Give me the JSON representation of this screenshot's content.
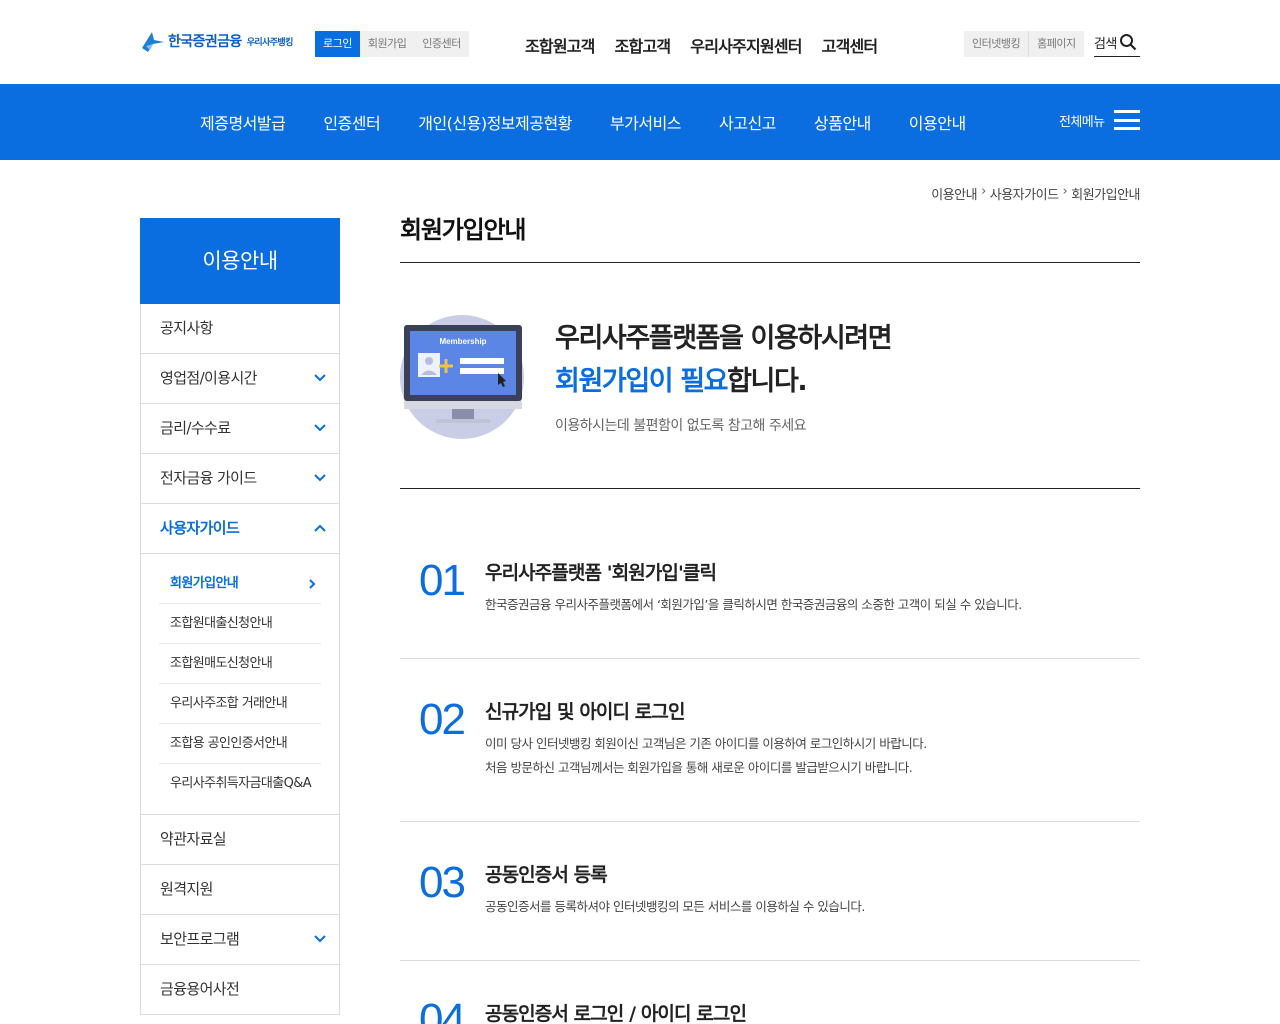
{
  "header": {
    "logo_main": "한국증권금융",
    "logo_sub": "우리사주뱅킹",
    "util_buttons": [
      "로그인",
      "회원가입",
      "인증센터"
    ],
    "gnb_top": [
      "조합원고객",
      "조합고객",
      "우리사주지원센터",
      "고객센터"
    ],
    "right_buttons": [
      "인터넷뱅킹",
      "홈페이지"
    ],
    "search_label": "검색"
  },
  "bluebar": {
    "menu": [
      "제증명서발급",
      "인증센터",
      "개인(신용)정보제공현황",
      "부가서비스",
      "사고신고",
      "상품안내",
      "이용안내"
    ],
    "all_menu_label": "전체메뉴"
  },
  "breadcrumb": [
    "이용안내",
    "사용자가이드",
    "회원가입안내"
  ],
  "sidebar": {
    "title": "이용안내",
    "items_before": [
      {
        "label": "공지사항",
        "expandable": false
      },
      {
        "label": "영업점/이용시간",
        "expandable": true
      },
      {
        "label": "금리/수수료",
        "expandable": true
      },
      {
        "label": "전자금융 가이드",
        "expandable": true
      }
    ],
    "active_item": "사용자가이드",
    "sub_items": [
      "회원가입안내",
      "조합원대출신청안내",
      "조합원매도신청안내",
      "우리사주조합 거래안내",
      "조합용 공인인증서안내",
      "우리사주취득자금대출Q&A"
    ],
    "items_after": [
      {
        "label": "약관자료실",
        "expandable": false
      },
      {
        "label": "원격지원",
        "expandable": false
      },
      {
        "label": "보안프로그램",
        "expandable": true
      },
      {
        "label": "금융용어사전",
        "expandable": false
      }
    ]
  },
  "main": {
    "page_title": "회원가입안내",
    "hero": {
      "illustration_label": "Membership",
      "line1": "우리사주플랫폼을 이용하시려면",
      "line2_highlight": "회원가입이 필요",
      "line2_rest": "합니다.",
      "sub": "이용하시는데 불편함이 없도록 참고해 주세요"
    },
    "steps": [
      {
        "num": "01",
        "title": "우리사주플랫폼 '회원가입'클릭",
        "desc": [
          "한국증권금융 우리사주플랫폼에서 ‘회원가입’을 클릭하시면 한국증권금융의 소중한 고객이 되실 수 있습니다."
        ]
      },
      {
        "num": "02",
        "title": "신규가입 및 아이디 로그인",
        "desc": [
          "이미 당사 인터넷뱅킹 회원이신 고객님은 기존 아이디를 이용하여 로그인하시기 바랍니다.",
          "처음 방문하신 고객님께서는 회원가입을 통해 새로운 아이디를 발급받으시기 바랍니다."
        ]
      },
      {
        "num": "03",
        "title": "공동인증서 등록",
        "desc": [
          "공동인증서를 등록하셔야 인터넷뱅킹의 모든 서비스를 이용하실 수 있습니다."
        ]
      },
      {
        "num": "04",
        "title": "공동인증서 로그인 / 아이디 로그인",
        "desc": []
      }
    ]
  },
  "colors": {
    "accent": "#0a6de0",
    "text": "#222222",
    "border": "#dcdcdc"
  }
}
